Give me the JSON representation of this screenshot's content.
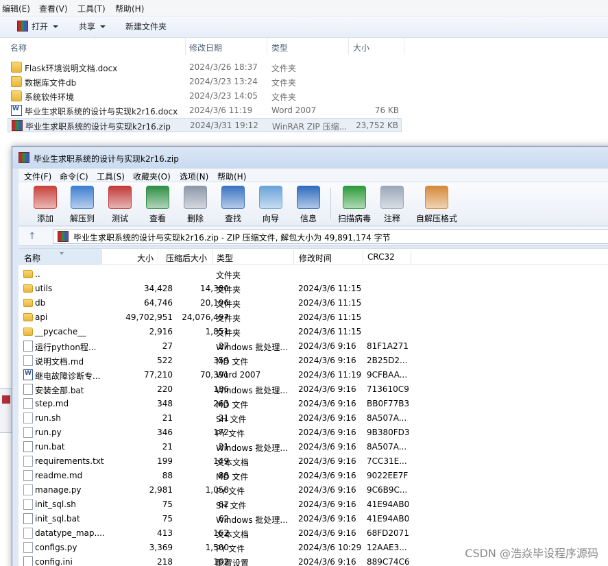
{
  "explorer": {
    "menu": [
      "编辑(E)",
      "查看(V)",
      "工具(T)",
      "帮助(H)"
    ],
    "toolbar": {
      "open": "打开",
      "share": "共享",
      "new_folder": "新建文件夹"
    },
    "columns": {
      "name": "名称",
      "date": "修改日期",
      "type": "类型",
      "size": "大小"
    },
    "files": [
      {
        "name": "Flask环境说明文档.docx",
        "date": "2024/3/26 18:37",
        "type": "文件夹",
        "size": "",
        "icon": "folder-icon"
      },
      {
        "name": "数据库文件db",
        "date": "2024/3/23 13:24",
        "type": "文件夹",
        "size": "",
        "icon": "folder-icon"
      },
      {
        "name": "系统软件环境",
        "date": "2024/3/23 14:05",
        "type": "文件夹",
        "size": "",
        "icon": "folder-icon"
      },
      {
        "name": "毕业生求职系统的设计与实现k2r16.docx",
        "date": "2024/3/6 11:19",
        "type": "Word 2007",
        "size": "76 KB",
        "icon": "word-doc-icon"
      },
      {
        "name": "毕业生求职系统的设计与实现k2r16.zip",
        "date": "2024/3/31 19:12",
        "type": "WinRAR ZIP 压缩...",
        "size": "23,752 KB",
        "icon": "winrar-archive-icon",
        "selected": true
      }
    ]
  },
  "winrar": {
    "title": "毕业生求职系统的设计与实现k2r16.zip",
    "menu": [
      "文件(F)",
      "命令(C)",
      "工具(S)",
      "收藏夹(O)",
      "选项(N)",
      "帮助(H)"
    ],
    "tools": [
      {
        "label": "添加",
        "icon": "add-archive-icon",
        "color": "#c8423c"
      },
      {
        "label": "解压到",
        "icon": "extract-to-icon",
        "color": "#3f7fd0"
      },
      {
        "label": "测试",
        "icon": "test-icon",
        "color": "#c23a3a"
      },
      {
        "label": "查看",
        "icon": "view-book-icon",
        "color": "#2f8f46"
      },
      {
        "label": "删除",
        "icon": "delete-bin-icon",
        "color": "#8d98a8"
      },
      {
        "label": "查找",
        "icon": "find-magnifier-icon",
        "color": "#3c74c4"
      },
      {
        "label": "向导",
        "icon": "wizard-wand-icon",
        "color": "#6aa3d8"
      },
      {
        "label": "信息",
        "icon": "info-icon",
        "color": "#2f6cc0"
      },
      {
        "label": "扫描病毒",
        "icon": "virus-scan-icon",
        "color": "#2e9b3a"
      },
      {
        "label": "注释",
        "icon": "comment-icon",
        "color": "#9aa7b8"
      },
      {
        "label": "自解压格式",
        "icon": "sfx-box-icon",
        "color": "#d58a3a"
      }
    ],
    "address": "毕业生求职系统的设计与实现k2r16.zip - ZIP 压缩文件, 解包大小为 49,891,174 字节",
    "columns": {
      "name": "名称",
      "size": "大小",
      "packed": "压缩后大小",
      "type": "类型",
      "modified": "修改时间",
      "crc": "CRC32"
    },
    "rows": [
      {
        "name": "..",
        "size": "",
        "packed": "",
        "type": "文件夹",
        "modified": "",
        "crc": "",
        "icon": "folder-icon"
      },
      {
        "name": "utils",
        "size": "34,428",
        "packed": "14,380",
        "type": "文件夹",
        "modified": "2024/3/6 11:15",
        "crc": "",
        "icon": "folder-icon"
      },
      {
        "name": "db",
        "size": "64,746",
        "packed": "20,196",
        "type": "文件夹",
        "modified": "2024/3/6 11:15",
        "crc": "",
        "icon": "folder-icon"
      },
      {
        "name": "api",
        "size": "49,702,951",
        "packed": "24,076,497",
        "type": "文件夹",
        "modified": "2024/3/6 11:15",
        "crc": "",
        "icon": "folder-icon"
      },
      {
        "name": "__pycache__",
        "size": "2,916",
        "packed": "1,851",
        "type": "文件夹",
        "modified": "2024/3/6 11:15",
        "crc": "",
        "icon": "folder-icon"
      },
      {
        "name": "运行python程...",
        "size": "27",
        "packed": "27",
        "type": "Windows 批处理...",
        "modified": "2024/3/6 9:16",
        "crc": "81F1A271",
        "icon": "batch-file-icon"
      },
      {
        "name": "说明文档.md",
        "size": "522",
        "packed": "359",
        "type": "MD 文件",
        "modified": "2024/3/6 9:16",
        "crc": "2B25D2...",
        "icon": "file-icon"
      },
      {
        "name": "继电故障诊断专...",
        "size": "77,210",
        "packed": "70,391",
        "type": "Word 2007",
        "modified": "2024/3/6 11:19",
        "crc": "9CFBAA...",
        "icon": "word-doc-icon"
      },
      {
        "name": "安装全部.bat",
        "size": "220",
        "packed": "136",
        "type": "Windows 批处理...",
        "modified": "2024/3/6 9:16",
        "crc": "713610C9",
        "icon": "batch-file-icon"
      },
      {
        "name": "step.md",
        "size": "348",
        "packed": "263",
        "type": "MD 文件",
        "modified": "2024/3/6 9:16",
        "crc": "BB0F77B3",
        "icon": "file-icon"
      },
      {
        "name": "run.sh",
        "size": "21",
        "packed": "21",
        "type": "SH 文件",
        "modified": "2024/3/6 9:16",
        "crc": "8A507A...",
        "icon": "file-icon"
      },
      {
        "name": "run.py",
        "size": "346",
        "packed": "172",
        "type": "PY 文件",
        "modified": "2024/3/6 9:16",
        "crc": "9B380FD3",
        "icon": "file-icon"
      },
      {
        "name": "run.bat",
        "size": "21",
        "packed": "21",
        "type": "Windows 批处理...",
        "modified": "2024/3/6 9:16",
        "crc": "8A507A...",
        "icon": "batch-file-icon"
      },
      {
        "name": "requirements.txt",
        "size": "199",
        "packed": "149",
        "type": "文本文档",
        "modified": "2024/3/6 9:16",
        "crc": "7CC31E...",
        "icon": "text-file-icon"
      },
      {
        "name": "readme.md",
        "size": "88",
        "packed": "88",
        "type": "MD 文件",
        "modified": "2024/3/6 9:16",
        "crc": "9022EE7F",
        "icon": "file-icon"
      },
      {
        "name": "manage.py",
        "size": "2,981",
        "packed": "1,058",
        "type": "PY 文件",
        "modified": "2024/3/6 9:16",
        "crc": "9C6B9C...",
        "icon": "file-icon"
      },
      {
        "name": "init_sql.sh",
        "size": "75",
        "packed": "62",
        "type": "SH 文件",
        "modified": "2024/3/6 9:16",
        "crc": "41E94AB0",
        "icon": "file-icon"
      },
      {
        "name": "init_sql.bat",
        "size": "75",
        "packed": "62",
        "type": "Windows 批处理...",
        "modified": "2024/3/6 9:16",
        "crc": "41E94AB0",
        "icon": "batch-file-icon"
      },
      {
        "name": "datatype_map....",
        "size": "413",
        "packed": "162",
        "type": "文本文档",
        "modified": "2024/3/6 9:16",
        "crc": "68FD2071",
        "icon": "text-file-icon"
      },
      {
        "name": "configs.py",
        "size": "3,369",
        "packed": "1,500",
        "type": "PY 文件",
        "modified": "2024/3/6 10:29",
        "crc": "12AAE3...",
        "icon": "file-icon"
      },
      {
        "name": "config.ini",
        "size": "218",
        "packed": "162",
        "type": "配置设置",
        "modified": "2024/3/6 9:16",
        "crc": "889C74C6",
        "icon": "config-file-icon"
      }
    ]
  },
  "watermark": "CSDN @浩焱毕设程序源码"
}
